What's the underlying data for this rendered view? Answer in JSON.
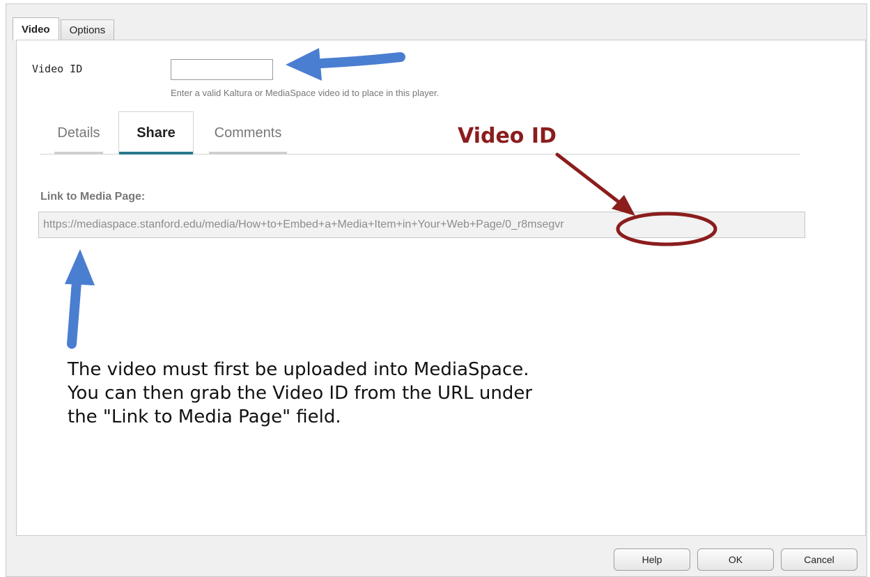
{
  "top_tabs": [
    {
      "label": "Video",
      "active": true
    },
    {
      "label": "Options",
      "active": false
    }
  ],
  "video_id_field": {
    "label": "Video ID",
    "value": "",
    "help_text": "Enter a valid Kaltura or MediaSpace video id to place in this player."
  },
  "inner_tabs": [
    {
      "label": "Details",
      "active": false
    },
    {
      "label": "Share",
      "active": true
    },
    {
      "label": "Comments",
      "active": false
    }
  ],
  "share": {
    "link_label": "Link to Media Page:",
    "link_value": "https://mediaspace.stanford.edu/media/How+to+Embed+a+Media+Item+in+Your+Web+Page/0_r8msegvr"
  },
  "annotation": {
    "title": "Video ID",
    "lines": [
      "The video must first be uploaded into MediaSpace.",
      "You can then grab the Video ID from the URL under",
      "the \"Link to Media Page\" field."
    ],
    "arrow_color": "#4a7ed0",
    "marker_color": "#8b1d1d"
  },
  "buttons": {
    "help": "Help",
    "ok": "OK",
    "cancel": "Cancel"
  },
  "colors": {
    "active_tab_underline": "#2a7a8c",
    "panel_background": "#ffffff",
    "window_background": "#f0f0f0"
  }
}
